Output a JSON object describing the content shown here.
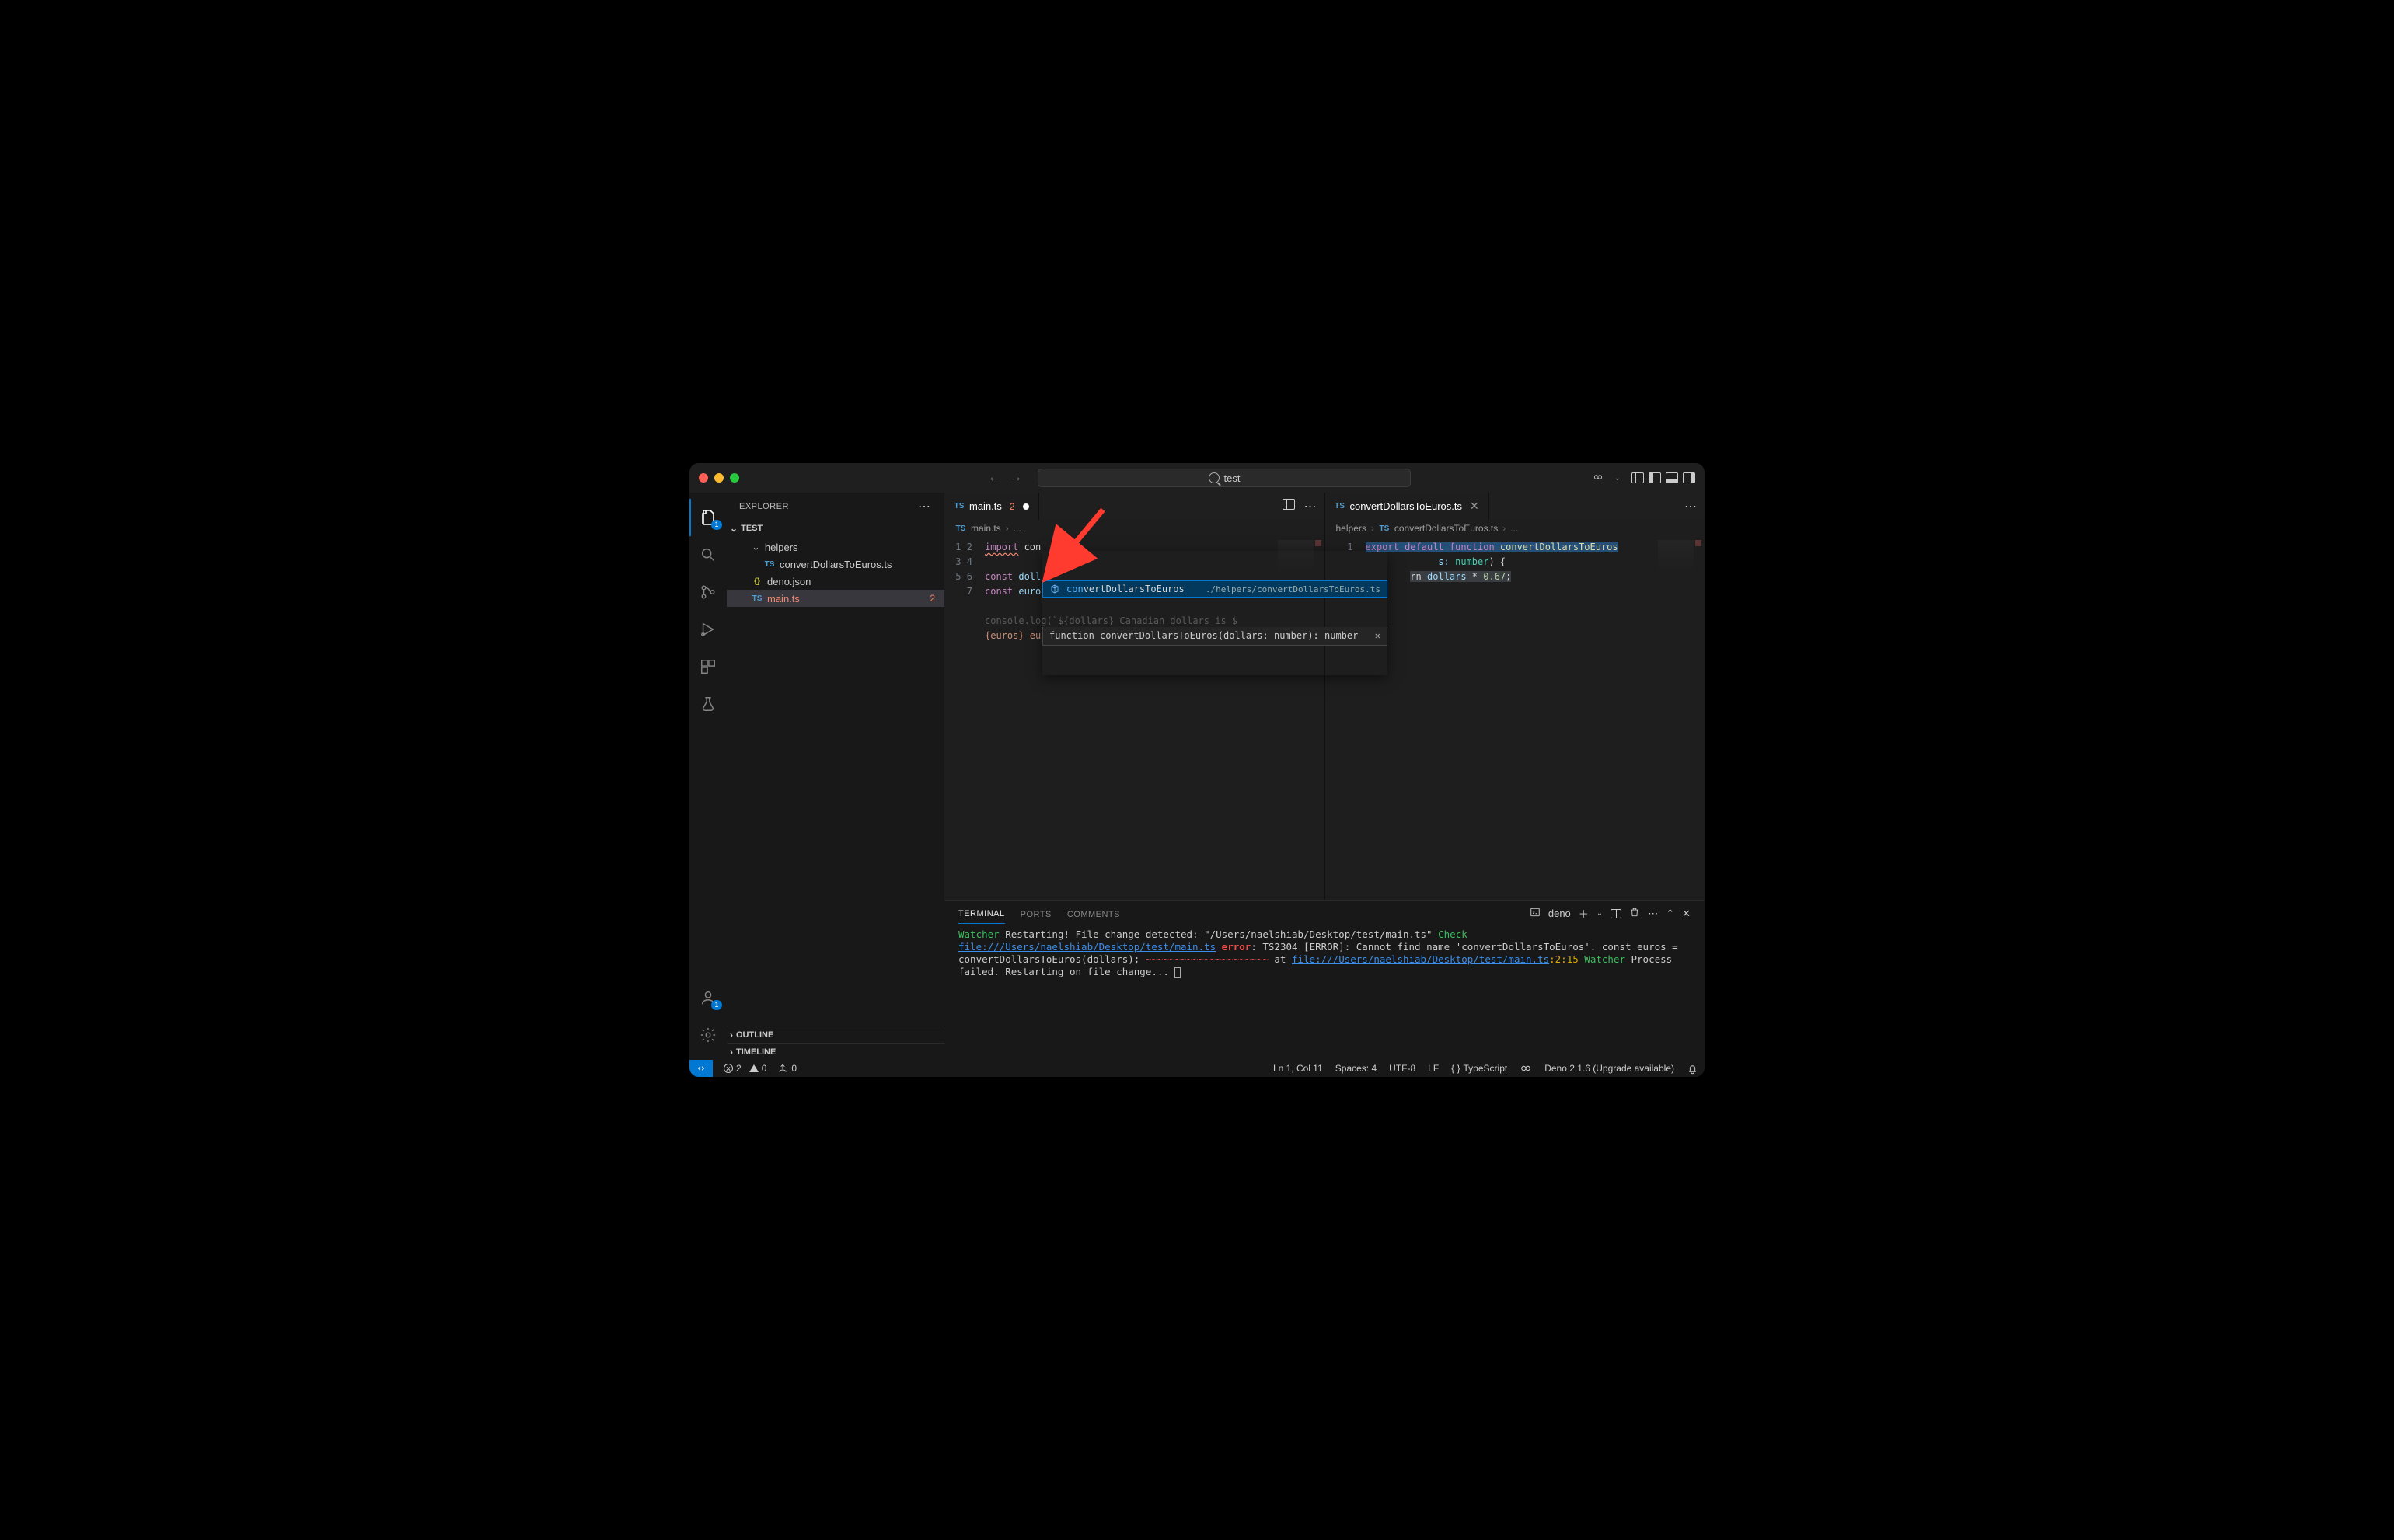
{
  "titlebar": {
    "search_text": "test"
  },
  "activitybar": {
    "explorer_badge": "1",
    "account_badge": "1"
  },
  "sidebar": {
    "title": "EXPLORER",
    "root": "TEST",
    "items": {
      "helpers": "helpers",
      "convert_file": "convertDollarsToEuros.ts",
      "deno": "deno.json",
      "main": "main.ts",
      "main_badge": "2"
    },
    "outline": "OUTLINE",
    "timeline": "TIMELINE"
  },
  "left_editor": {
    "tab_label": "main.ts",
    "tab_error_count": "2",
    "breadcrumb_file": "main.ts",
    "lines": [
      "1",
      "2",
      "3",
      "4",
      "5",
      "6",
      "",
      "7"
    ],
    "code": {
      "l1_kw": "import",
      "l1_typed": " con",
      "l3_kw": "const ",
      "l3_var": "doll",
      "l4_kw": "const ",
      "l4_var": "euro",
      "l6a_obj": "console",
      "l6a_fn": ".log",
      "l6a_paren": "(",
      "l6a_str": "`${dollars} Canadian dollars is $",
      "l6b_str": "{euros} euros`",
      "l6b_end": ");"
    },
    "autocomplete": {
      "match": "con",
      "rest": "vertDollarsToEuros",
      "path": "./helpers/convertDollarsToEuros.ts",
      "detail": "function convertDollarsToEuros(dollars: number): number"
    }
  },
  "right_editor": {
    "tab_label": "convertDollarsToEuros.ts",
    "breadcrumb_folder": "helpers",
    "breadcrumb_file": "convertDollarsToEuros.ts",
    "lines": [
      "1"
    ],
    "code": {
      "kw_export": "export",
      "kw_default": " default",
      "kw_function": " function",
      "fn_name": " convertDollarsToEuros",
      "frag_s": "s: ",
      "type_num": "number",
      "frag_paren": ") {",
      "frag_rn": "rn ",
      "var_dollars": "dollars",
      "op_star": " * ",
      "num_067": "0.67",
      "semi": ";"
    }
  },
  "panel": {
    "tabs": {
      "terminal": "TERMINAL",
      "ports": "PORTS",
      "comments": "COMMENTS"
    },
    "shell_label": "deno",
    "terminal": {
      "l1_watcher": "Watcher",
      "l1_rest": " Restarting! File change detected: \"/Users/naelshiab/Desktop/test/main.ts\"",
      "l2_check": "Check",
      "l2_path": " file:///Users/naelshiab/Desktop/test/main.ts",
      "l3_error": "error",
      "l3_rest": ": TS2304 [ERROR]: Cannot find name 'convertDollarsToEuros'.",
      "l4": "const euros = convertDollarsToEuros(dollars);",
      "l5_wave": "              ~~~~~~~~~~~~~~~~~~~~~",
      "l6_at": "    at ",
      "l6_path": "file:///Users/naelshiab/Desktop/test/main.ts",
      "l6_loc": ":2:15",
      "l7_watcher": "Watcher",
      "l7_rest": " Process failed. Restarting on file change..."
    }
  },
  "status": {
    "errors": "2",
    "warnings": "0",
    "port": "0",
    "cursor": "Ln 1, Col 11",
    "spaces": "Spaces: 4",
    "encoding": "UTF-8",
    "eol": "LF",
    "language": "TypeScript",
    "deno": "Deno 2.1.6 (Upgrade available)"
  }
}
